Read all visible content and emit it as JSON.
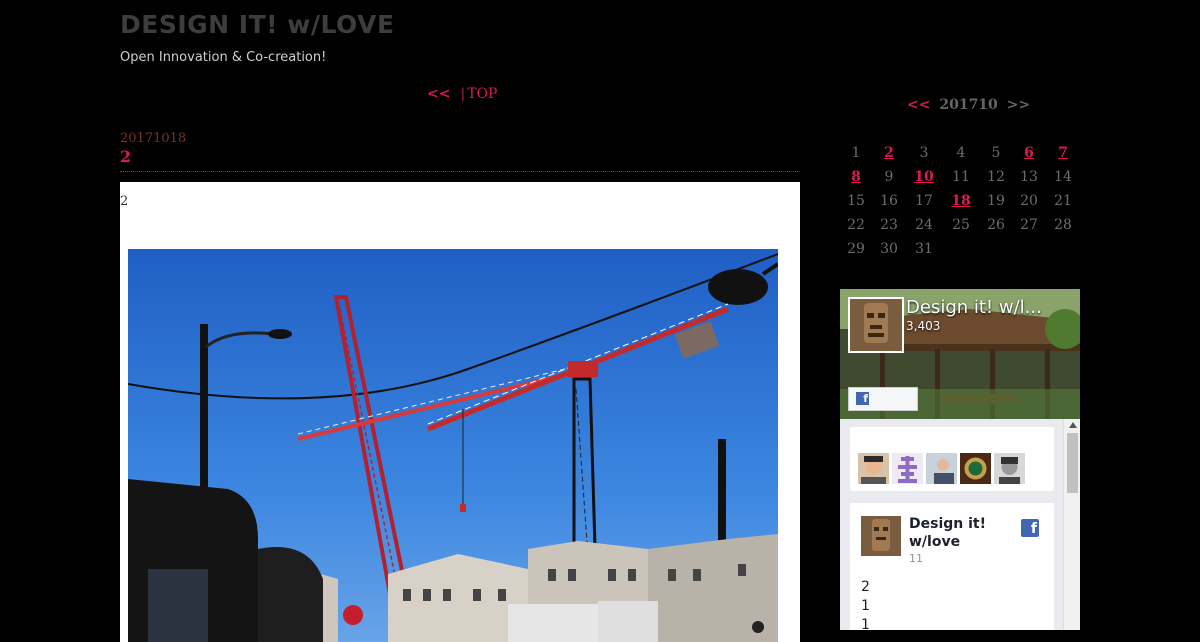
{
  "site": {
    "title": "DESIGN IT! w/LOVE",
    "description": "Open Innovation & Co-creation!"
  },
  "nav": {
    "prev_label": "<<",
    "separator": "|",
    "top_label": "TOP"
  },
  "post": {
    "date": "20171018",
    "title": "2",
    "body_text": "2"
  },
  "calendar": {
    "prev_label": "<<",
    "month_label": "201710",
    "next_label": ">>",
    "weeks": [
      [
        {
          "d": "1",
          "link": false
        },
        {
          "d": "2",
          "link": true
        },
        {
          "d": "3",
          "link": false
        },
        {
          "d": "4",
          "link": false
        },
        {
          "d": "5",
          "link": false
        },
        {
          "d": "6",
          "link": true
        },
        {
          "d": "7",
          "link": true
        }
      ],
      [
        {
          "d": "8",
          "link": true
        },
        {
          "d": "9",
          "link": false
        },
        {
          "d": "10",
          "link": true
        },
        {
          "d": "11",
          "link": false
        },
        {
          "d": "12",
          "link": false
        },
        {
          "d": "13",
          "link": false
        },
        {
          "d": "14",
          "link": false
        }
      ],
      [
        {
          "d": "15",
          "link": false
        },
        {
          "d": "16",
          "link": false
        },
        {
          "d": "17",
          "link": false
        },
        {
          "d": "18",
          "link": true
        },
        {
          "d": "19",
          "link": false
        },
        {
          "d": "20",
          "link": false
        },
        {
          "d": "21",
          "link": false
        }
      ],
      [
        {
          "d": "22",
          "link": false
        },
        {
          "d": "23",
          "link": false
        },
        {
          "d": "24",
          "link": false
        },
        {
          "d": "25",
          "link": false
        },
        {
          "d": "26",
          "link": false
        },
        {
          "d": "27",
          "link": false
        },
        {
          "d": "28",
          "link": false
        }
      ],
      [
        {
          "d": "29",
          "link": false
        },
        {
          "d": "30",
          "link": false
        },
        {
          "d": "31",
          "link": false
        }
      ]
    ]
  },
  "fb_widget": {
    "page_name": "Design it! w/l...",
    "like_count": "3,403",
    "like_icon": "f",
    "post": {
      "author": "Design it! w/love",
      "time": "11",
      "icon": "f",
      "lines": [
        "2",
        "1",
        "1"
      ]
    }
  },
  "colors": {
    "background": "#000000",
    "accent": "#e0165c",
    "title_gray": "#3d3d3d",
    "facebook_blue": "#4267b2"
  }
}
